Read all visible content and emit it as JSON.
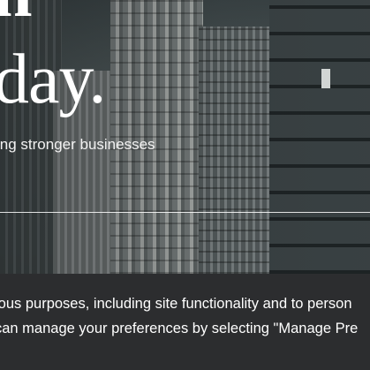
{
  "hero": {
    "headline_partial_top": "n",
    "headline": "oday.",
    "subtitle": "ing stronger businesses"
  },
  "cookie_banner": {
    "line1": "ious purposes, including site functionality and to person",
    "line2": " can manage your preferences by selecting \"Manage Pre"
  }
}
